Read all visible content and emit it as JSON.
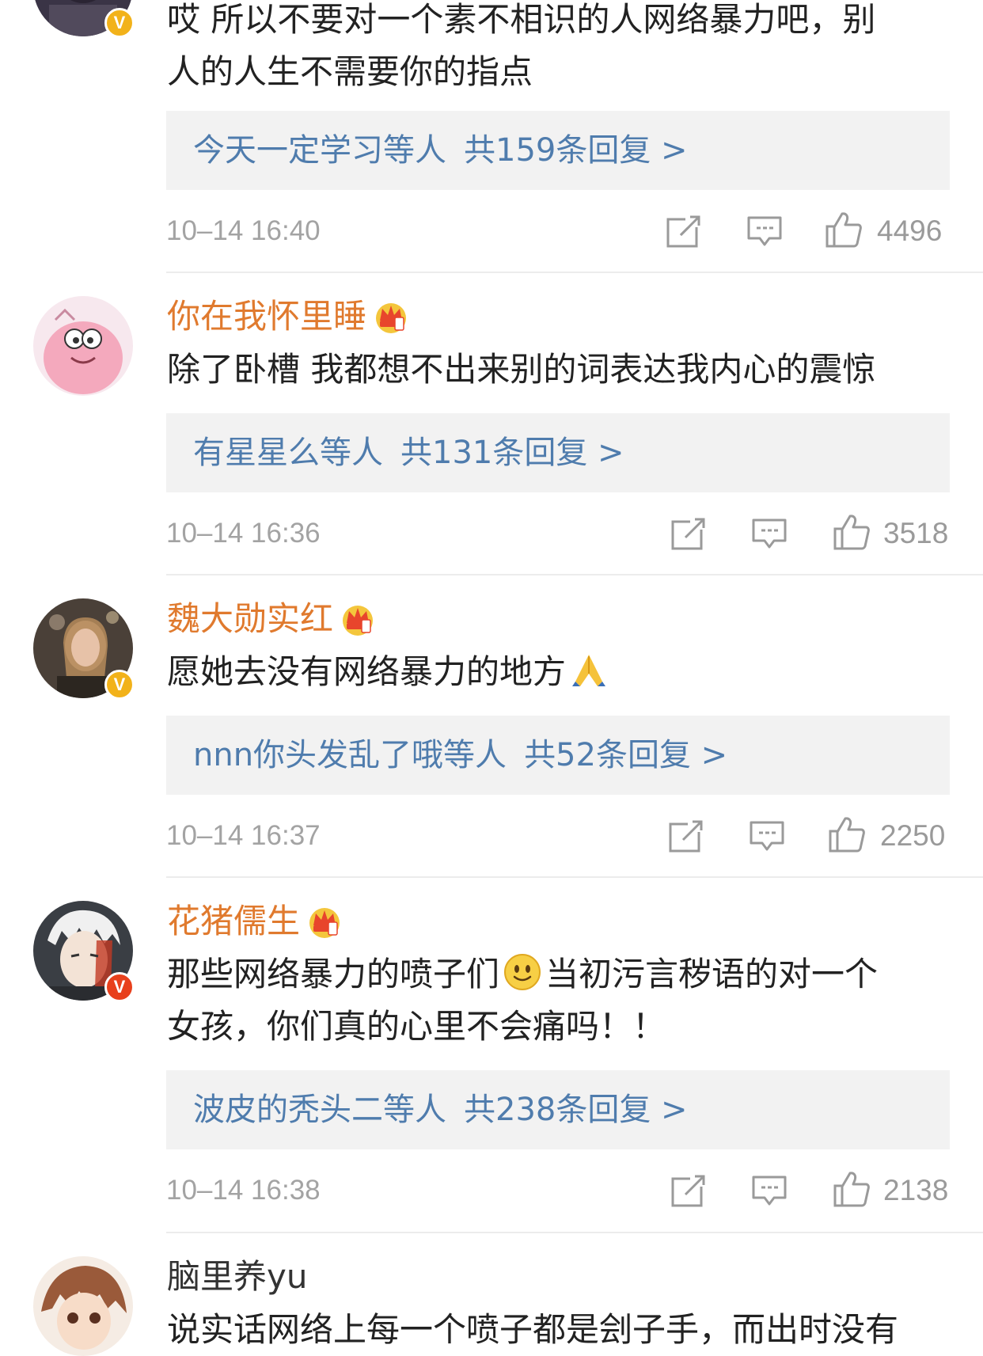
{
  "comments": [
    {
      "username": "",
      "text_lines": [
        "哎 所以不要对一个素不相识的人网络暴力吧，别",
        "人的人生不需要你的指点"
      ],
      "verified": "gold",
      "reply_preview": "今天一定学习等人",
      "reply_count": "共159条回复 >",
      "time": "10–14 16:40",
      "likes": "4496"
    },
    {
      "username": "你在我怀里睡",
      "crown": true,
      "text_lines": [
        "除了卧槽 我都想不出来别的词表达我内心的震惊"
      ],
      "reply_preview": "有星星么等人",
      "reply_count": "共131条回复 >",
      "time": "10–14 16:36",
      "likes": "3518"
    },
    {
      "username": "魏大勋实红",
      "crown": true,
      "verified": "gold",
      "text_lines": [
        "愿她去没有网络暴力的地方"
      ],
      "text_emoji": "pray-emoji",
      "reply_preview": "nnn你头发乱了哦等人",
      "reply_count": "共52条回复 >",
      "time": "10–14 16:37",
      "likes": "2250"
    },
    {
      "username": "花猪儒生",
      "crown": true,
      "verified": "red",
      "text_line1_a": "那些网络暴力的喷子们",
      "text_line1_b": "当初污言秽语的对一个",
      "text_line2": "女孩，你们真的心里不会痛吗！！",
      "text_emoji": "smile-emoji",
      "reply_preview": "波皮的秃头二等人",
      "reply_count": "共238条回复 >",
      "time": "10–14 16:38",
      "likes": "2138"
    },
    {
      "username": "脑里养yu",
      "text_partial": "说实话网络上每一个喷子都是刽子手，而出时没有"
    }
  ],
  "icons": {
    "verified_badge": "V",
    "actions": [
      "share-icon",
      "comment-icon",
      "like-icon"
    ]
  },
  "colors": {
    "username": "#e07a2e",
    "reply_link": "#4f7cad",
    "reply_bg": "#f2f2f2",
    "meta": "#a3a3a3",
    "badge_gold": "#f2b21a",
    "badge_red": "#e8401c"
  }
}
